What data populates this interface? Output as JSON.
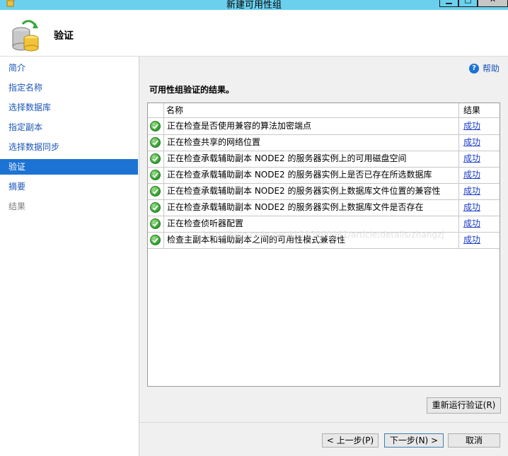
{
  "window": {
    "title": "新建可用性组",
    "min_label": "▁",
    "max_label": "□",
    "close_label": "✕"
  },
  "header": {
    "title": "验证"
  },
  "sidebar": {
    "items": [
      {
        "label": "简介",
        "state": "link"
      },
      {
        "label": "指定名称",
        "state": "link"
      },
      {
        "label": "选择数据库",
        "state": "link"
      },
      {
        "label": "指定副本",
        "state": "link"
      },
      {
        "label": "选择数据同步",
        "state": "link"
      },
      {
        "label": "验证",
        "state": "active"
      },
      {
        "label": "摘要",
        "state": "link"
      },
      {
        "label": "结果",
        "state": "disabled"
      }
    ]
  },
  "help": {
    "label": "帮助",
    "icon": "question-icon"
  },
  "main": {
    "section_title": "可用性组验证的结果。",
    "columns": {
      "name": "名称",
      "result": "结果"
    },
    "rows": [
      {
        "name": "正在检查是否使用兼容的算法加密端点",
        "result": "成功"
      },
      {
        "name": "正在检查共享的网络位置",
        "result": "成功"
      },
      {
        "name": "正在检查承载辅助副本 NODE2 的服务器实例上的可用磁盘空间",
        "result": "成功"
      },
      {
        "name": "正在检查承载辅助副本 NODE2 的服务器实例上是否已存在所选数据库",
        "result": "成功"
      },
      {
        "name": "正在检查承载辅助副本 NODE2 的服务器实例上数据库文件位置的兼容性",
        "result": "成功"
      },
      {
        "name": "正在检查承载辅助副本 NODE2 的服务器实例上数据库文件是否存在",
        "result": "成功"
      },
      {
        "name": "正在检查侦听器配置",
        "result": "成功"
      },
      {
        "name": "检查主副本和辅助副本之间的可用性模式兼容性",
        "result": "成功"
      }
    ],
    "watermark": "http://blog.csdn.net/kk185800961/article/details/zhangzj",
    "rerun_button": "重新运行验证(R)"
  },
  "footer": {
    "prev_button": "< 上一步(P)",
    "next_button": "下一步(N) >",
    "cancel_button": "取消"
  },
  "colors": {
    "accent": "#1c73d4",
    "titlebar": "#6bd0ee",
    "link": "#1a56b8",
    "success": "#2e9d2a"
  }
}
